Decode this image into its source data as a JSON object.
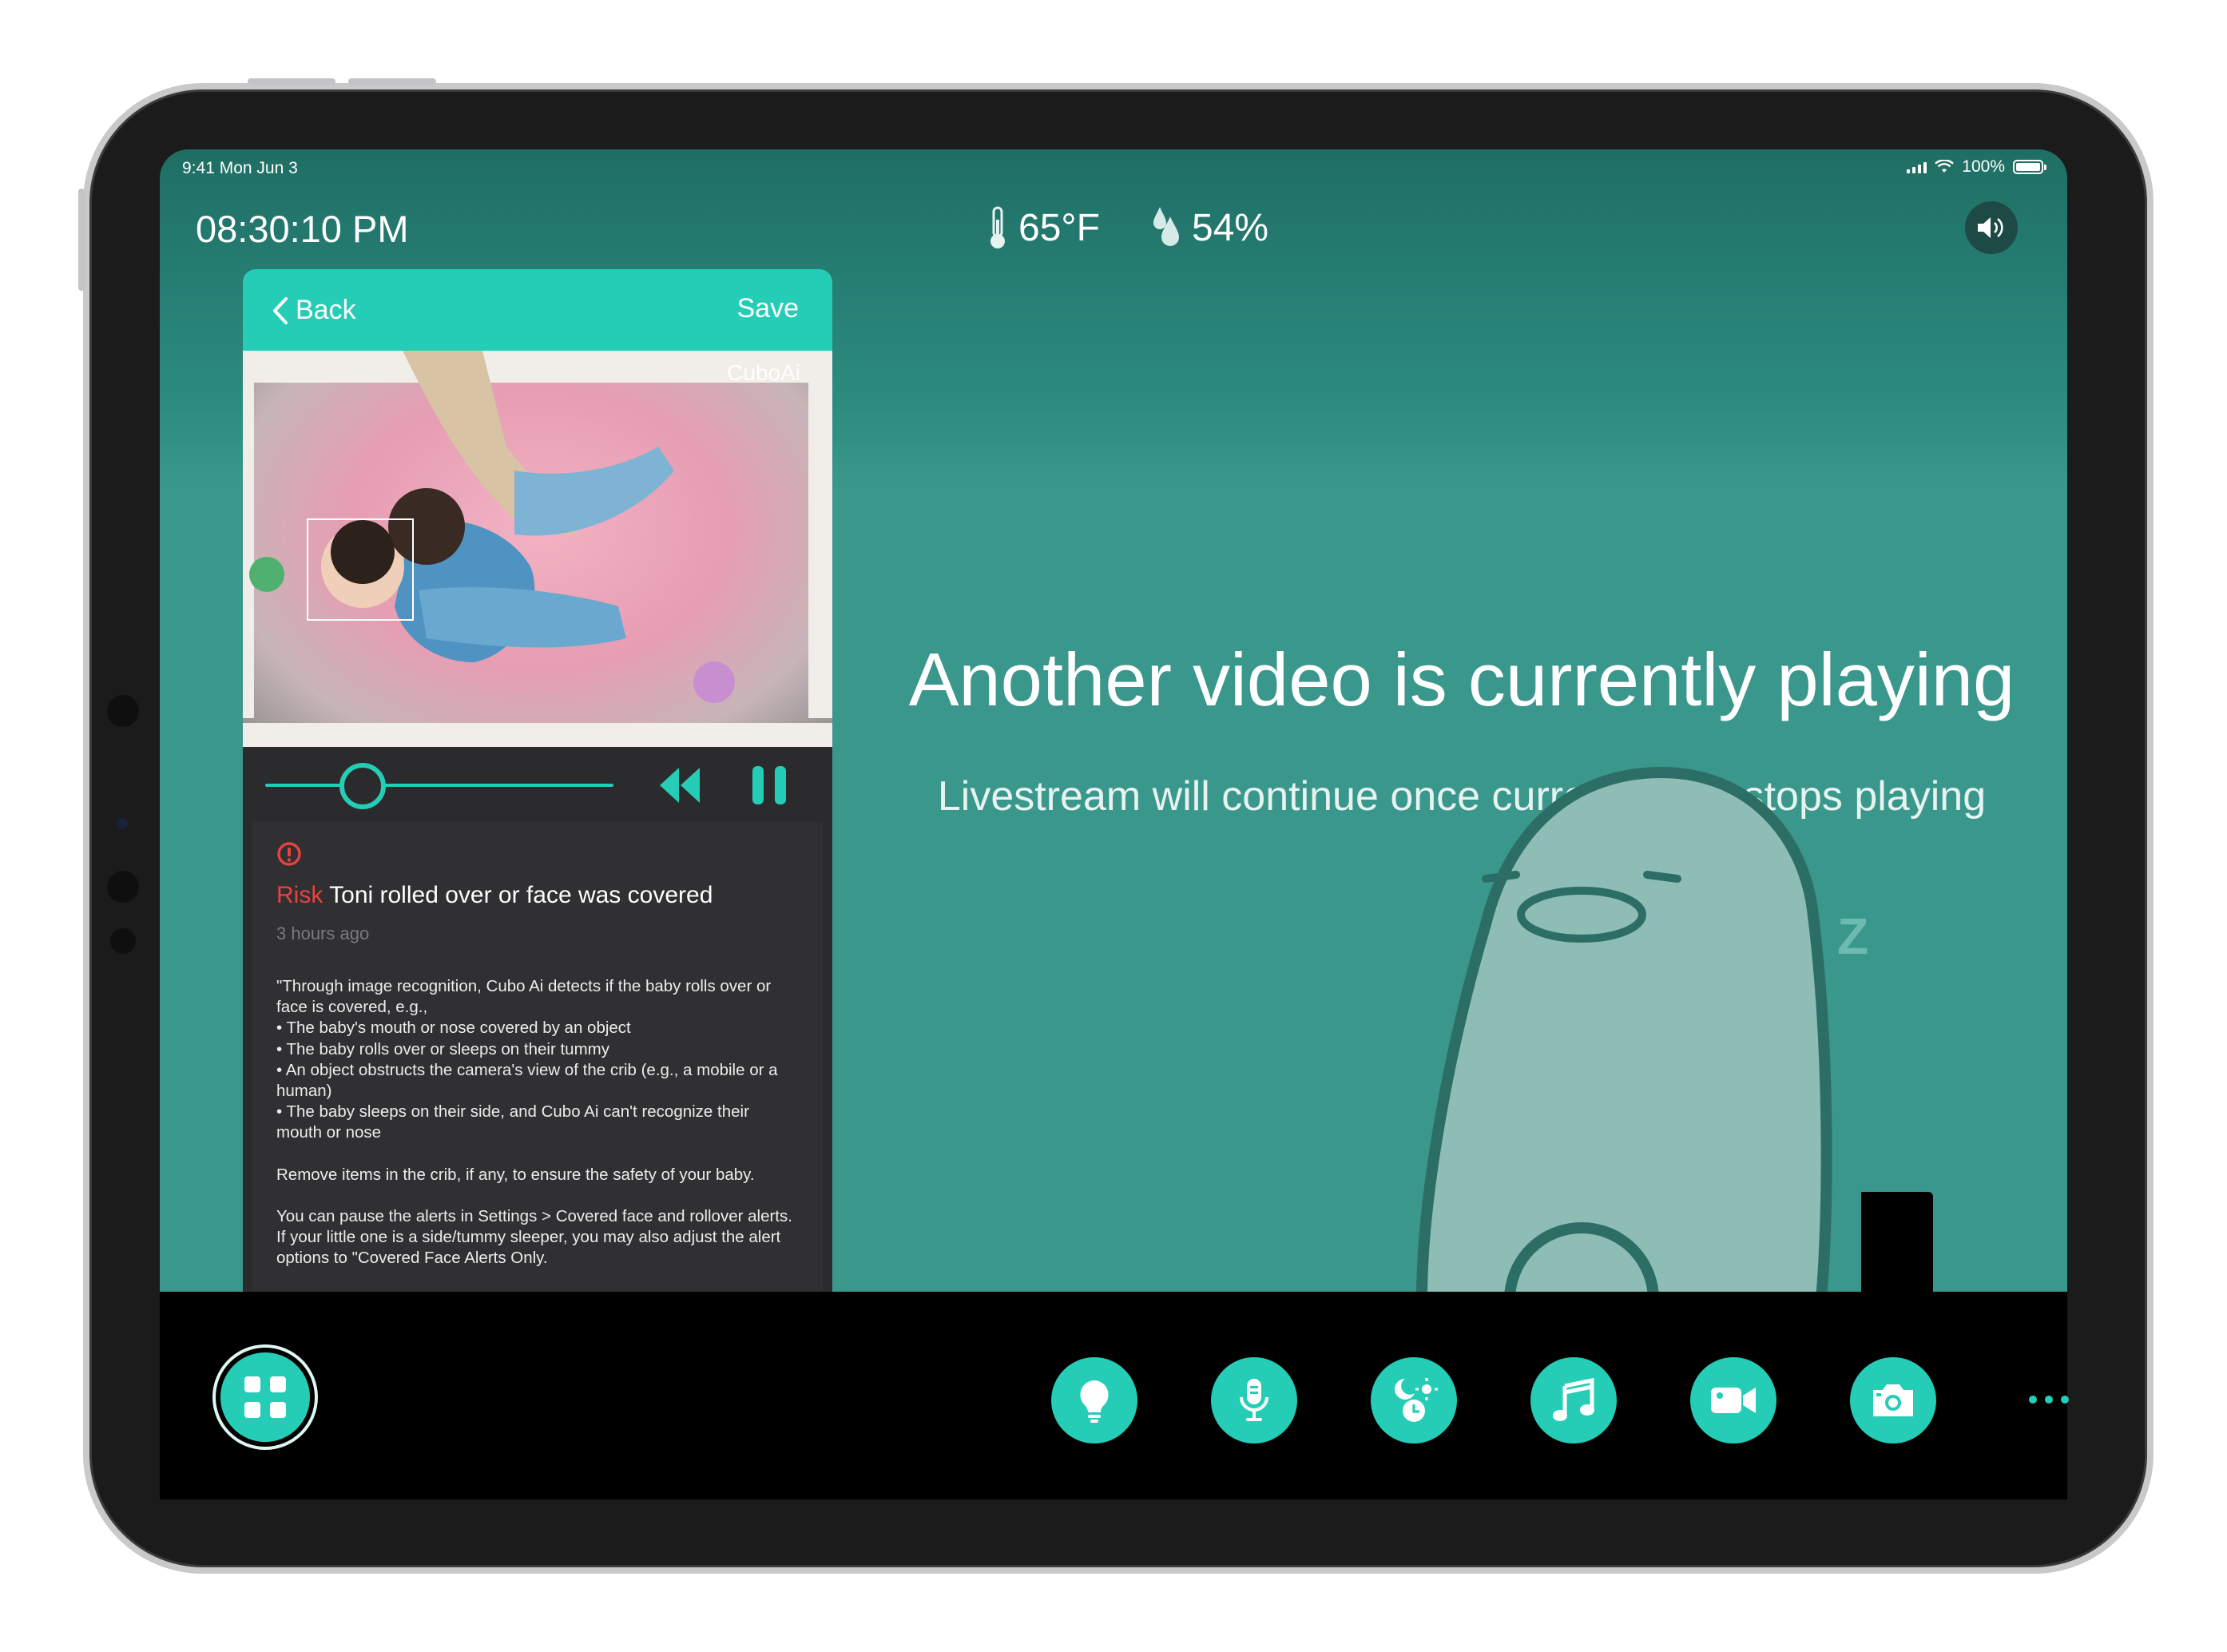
{
  "status_bar": {
    "time": "9:41  Mon Jun 3",
    "battery": "100%"
  },
  "header": {
    "clock": "08:30:10 PM",
    "temperature": "65°F",
    "humidity": "54%"
  },
  "card": {
    "back_label": "Back",
    "save_label": "Save",
    "brand": "CuboAi",
    "playback_position": 0.28,
    "risk_label": "Risk",
    "alert_title": "Toni rolled over or face was covered",
    "time_ago": "3 hours ago",
    "description": [
      "\"Through image recognition, Cubo Ai detects if the baby rolls over or face is covered, e.g.,",
      " • The baby's mouth or nose covered by an object",
      " • The baby rolls over or sleeps on their tummy",
      " • An object obstructs the camera's view of the crib (e.g., a mobile or a human)",
      " • The baby sleeps on their side, and Cubo Ai can't recognize their mouth or nose",
      "",
      "Remove items in the crib, if any, to ensure the safety of your baby.",
      "",
      "You can pause the alerts in Settings > Covered face and rollover alerts. If your little one is a side/tummy sleeper, you may also adjust the alert options to \"Covered Face Alerts Only."
    ]
  },
  "main": {
    "headline": "Another video is currently playing",
    "subline": "Livestream will continue once current video stops playing",
    "z_large": "Z",
    "z_small": "Z"
  },
  "toolbar": {
    "buttons": [
      "bulb-icon",
      "microphone-icon",
      "sleep-schedule-icon",
      "music-note-icon",
      "video-camera-icon",
      "camera-icon"
    ]
  },
  "colors": {
    "accent": "#25cdb6",
    "risk": "#e9413f",
    "background": "#3a978b",
    "card": "#2b2b2d"
  }
}
